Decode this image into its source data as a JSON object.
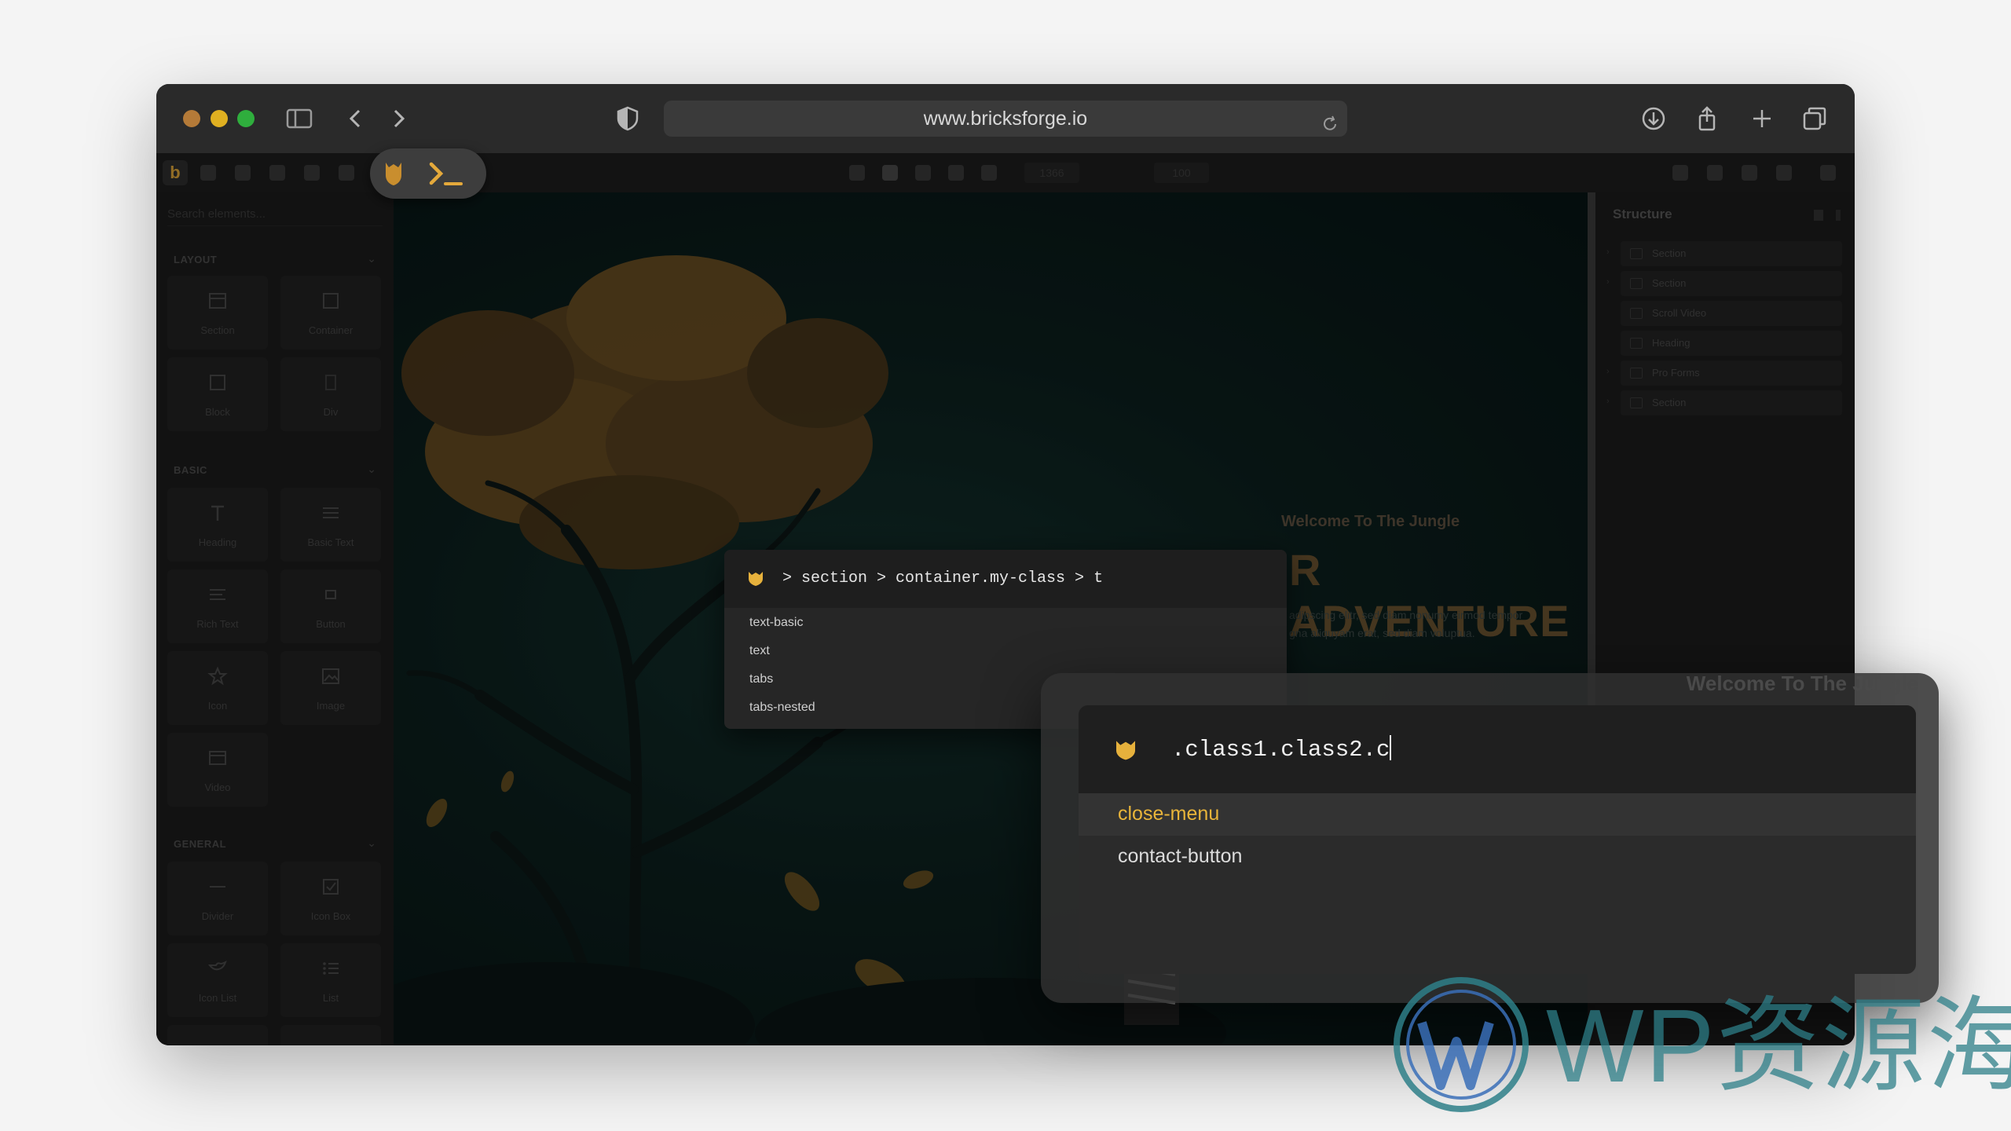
{
  "browser": {
    "url": "www.bricksforge.io",
    "traffic_colors": [
      "#b47a38",
      "#e0b021",
      "#2fae3d"
    ]
  },
  "builder": {
    "search_placeholder": "Search elements...",
    "categories": {
      "layout": "LAYOUT",
      "basic": "BASIC",
      "general": "GENERAL"
    },
    "layout_elements": [
      "Section",
      "Container",
      "Block",
      "Div"
    ],
    "basic_elements": [
      "Heading",
      "Basic Text",
      "Rich Text",
      "Button",
      "Icon",
      "Image",
      "Video"
    ],
    "general_elements": [
      "Divider",
      "Icon Box",
      "Icon List",
      "List"
    ],
    "toolbar_width": "1366",
    "toolbar_zoom": "100"
  },
  "structure": {
    "title": "Structure",
    "items": [
      "Section",
      "Section",
      "Scroll Video",
      "Heading",
      "Pro Forms",
      "Section"
    ]
  },
  "canvas": {
    "welcome": "Welcome To The Jungle",
    "headline": "R ADVENTURE",
    "lorem_line1": "adipscing elitr, sed diam nonumy eirmod tempor",
    "lorem_line2": "gna aliquyam erat, sed diam voluptua."
  },
  "terminal": {
    "query": "> section > container.my-class > t",
    "options": [
      "text-basic",
      "text",
      "tabs",
      "tabs-nested"
    ]
  },
  "command": {
    "query": ".class1.class2.c",
    "options": [
      "close-menu",
      "contact-button"
    ],
    "active_color": "#e8b43a"
  },
  "watermark": {
    "text": "WP资源海"
  }
}
